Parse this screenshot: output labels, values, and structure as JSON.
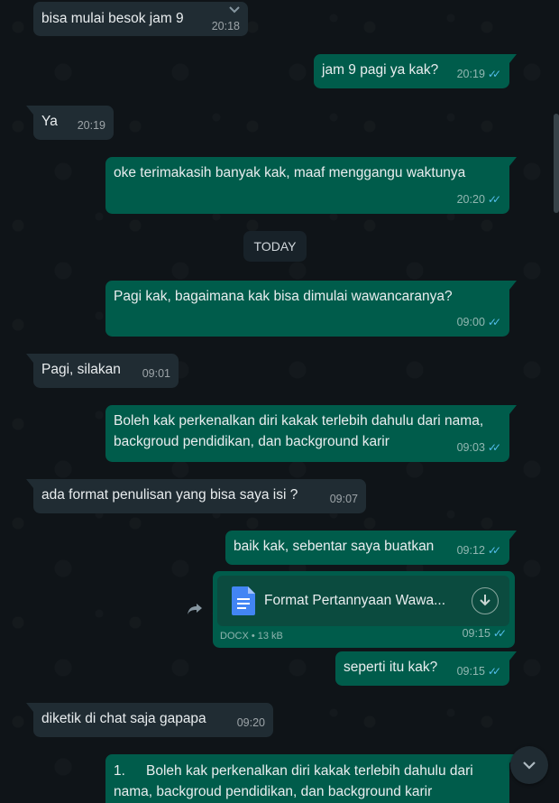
{
  "date_divider": "TODAY",
  "messages": [
    {
      "text": "bisa mulai besok jam 9",
      "time": "20:18"
    },
    {
      "text": "jam 9 pagi ya kak?",
      "time": "20:19"
    },
    {
      "text": "Ya",
      "time": "20:19"
    },
    {
      "text": "oke terimakasih banyak kak, maaf menggangu waktunya",
      "time": "20:20"
    },
    {
      "text": "Pagi kak, bagaimana kak bisa dimulai wawancaranya?",
      "time": "09:00"
    },
    {
      "text": "Pagi, silakan",
      "time": "09:01"
    },
    {
      "text": "Boleh kak perkenalkan diri kakak terlebih dahulu dari nama, backgroud pendidikan, dan background karir",
      "time": "09:03"
    },
    {
      "text": "ada format penulisan yang bisa saya isi ?",
      "time": "09:07"
    },
    {
      "text": "baik kak, sebentar saya buatkan",
      "time": "09:12"
    },
    {
      "text": "seperti itu kak?",
      "time": "09:15"
    },
    {
      "text": "diketik di chat saja gapapa",
      "time": "09:20"
    },
    {
      "num": "1.",
      "text": "Boleh kak perkenalkan diri kakak terlebih dahulu dari nama, backgroud pendidikan, dan background karir"
    }
  ],
  "document": {
    "name": "Format Pertannyaan Wawa...",
    "type": "DOCX",
    "size": "13 kB",
    "time": "09:15"
  },
  "colors": {
    "incoming": "#202c33",
    "outgoing": "#005c4b",
    "read_ticks": "#53bdeb"
  },
  "icons": {
    "read": "double-check-icon",
    "menu": "chevron-down-icon",
    "forward": "forward-icon",
    "download": "download-icon",
    "scroll": "scroll-down-icon",
    "doc": "document-icon"
  }
}
